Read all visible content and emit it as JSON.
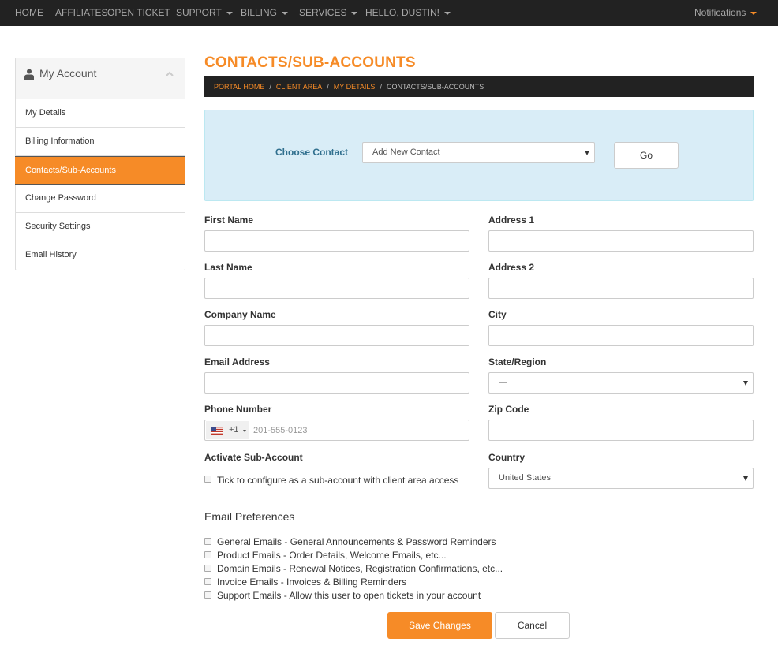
{
  "nav": {
    "home": "HOME",
    "affiliates": "AFFILIATES",
    "open_ticket": "OPEN TICKET",
    "support": "SUPPORT",
    "billing": "BILLING",
    "services": "SERVICES",
    "user": "HELLO, DUSTIN!",
    "notifications": "Notifications"
  },
  "sidebar": {
    "title": "My Account",
    "items": [
      {
        "label": "My Details"
      },
      {
        "label": "Billing Information"
      },
      {
        "label": "Contacts/Sub-Accounts",
        "active": true
      },
      {
        "label": "Change Password"
      },
      {
        "label": "Security Settings"
      },
      {
        "label": "Email History"
      }
    ]
  },
  "page_title": "CONTACTS/SUB-ACCOUNTS",
  "breadcrumb": {
    "items": [
      "PORTAL HOME",
      "CLIENT AREA",
      "MY DETAILS"
    ],
    "current": "CONTACTS/SUB-ACCOUNTS"
  },
  "choose_contact": {
    "label": "Choose Contact",
    "selected": "Add New Contact",
    "go_label": "Go"
  },
  "form": {
    "first_name": "First Name",
    "last_name": "Last Name",
    "company_name": "Company Name",
    "email_address": "Email Address",
    "phone_number": "Phone Number",
    "phone_code": "+1",
    "phone_placeholder": "201-555-0123",
    "activate_label": "Activate Sub-Account",
    "activate_text": "Tick to configure as a sub-account with client area access",
    "address1": "Address 1",
    "address2": "Address 2",
    "city": "City",
    "state_region": "State/Region",
    "state_value": "—",
    "zip_code": "Zip Code",
    "country": "Country",
    "country_value": "United States"
  },
  "email_prefs": {
    "title": "Email Preferences",
    "items": [
      "General Emails - General Announcements & Password Reminders",
      "Product Emails - Order Details, Welcome Emails, etc...",
      "Domain Emails - Renewal Notices, Registration Confirmations, etc...",
      "Invoice Emails - Invoices & Billing Reminders",
      "Support Emails - Allow this user to open tickets in your account"
    ]
  },
  "actions": {
    "save": "Save Changes",
    "cancel": "Cancel"
  },
  "colors": {
    "accent": "#f68b27",
    "nav_bg": "#222222",
    "info_bg": "#d9edf7"
  }
}
